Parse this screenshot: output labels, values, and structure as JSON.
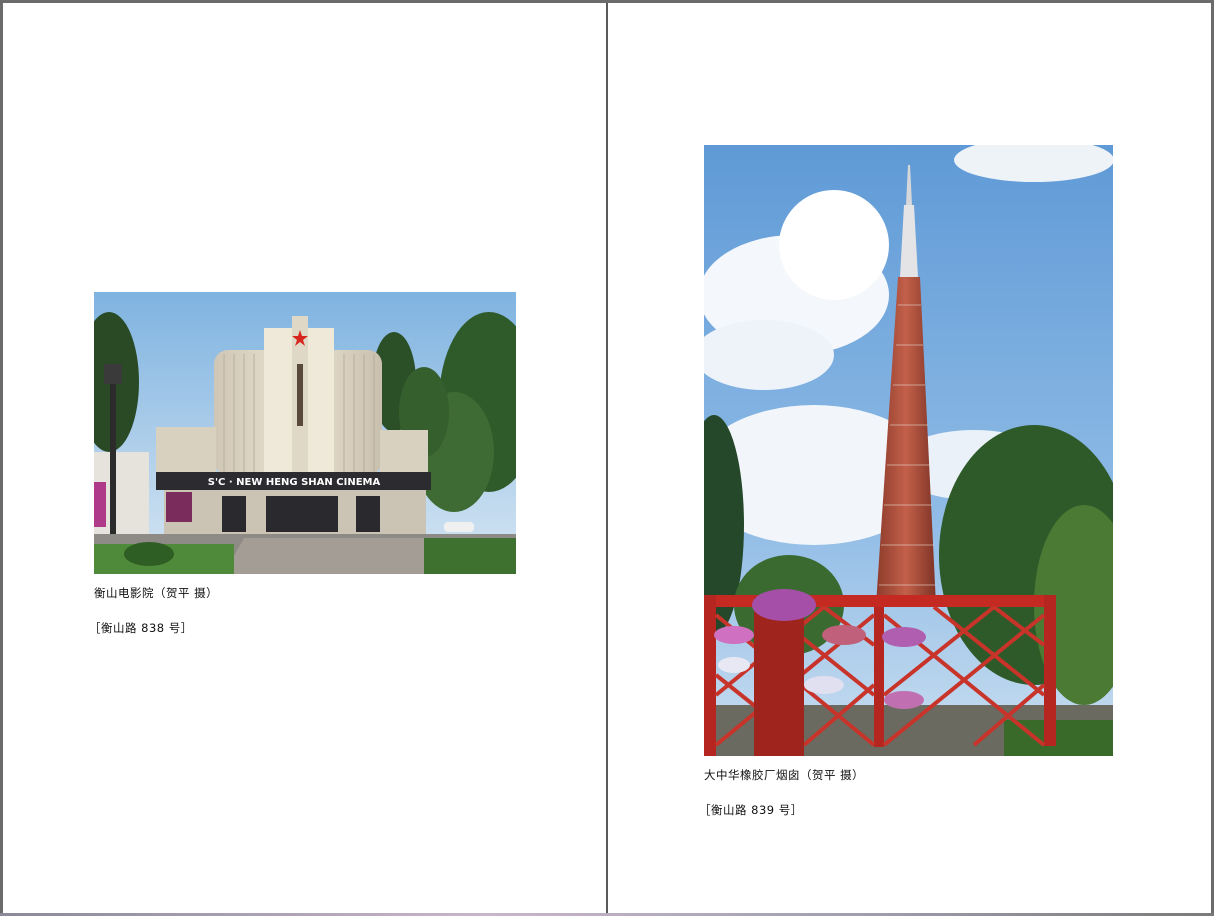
{
  "left_page": {
    "photo": {
      "sign_text": "S'C · NEW HENG SHAN CINEMA"
    },
    "caption": "衡山电影院（贺平 摄）",
    "address": "［衡山路 838 号］"
  },
  "right_page": {
    "caption": "大中华橡胶厂烟囱（贺平 摄）",
    "address": "［衡山路 839 号］"
  }
}
